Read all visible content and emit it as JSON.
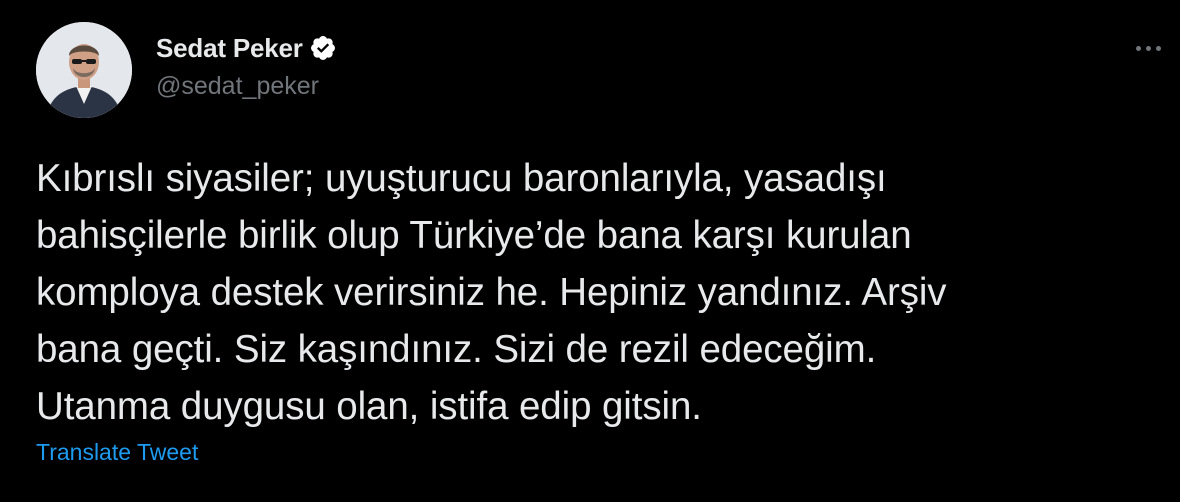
{
  "author": {
    "display_name": "Sedat Peker",
    "handle": "@sedat_peker",
    "verified": true,
    "avatar_icon": "profile-photo"
  },
  "tweet": {
    "lines": [
      "Kıbrıslı siyasiler; uyuşturucu baronlarıyla, yasadışı",
      "bahisçilerle birlik olup Türkiye’de bana karşı kurulan",
      "komploya destek verirsiniz he. Hepiniz yandınız. Arşiv",
      "bana geçti. Siz kaşındınız. Sizi de rezil edeceğim.",
      "Utanma duygusu olan, istifa edip gitsin."
    ]
  },
  "actions": {
    "translate_label": "Translate Tweet",
    "more_icon": "more-horizontal-icon"
  },
  "colors": {
    "background": "#000000",
    "text_primary": "#e7e9ea",
    "text_secondary": "#71767b",
    "accent": "#1d9bf0",
    "verified_badge": "#ffffff"
  }
}
